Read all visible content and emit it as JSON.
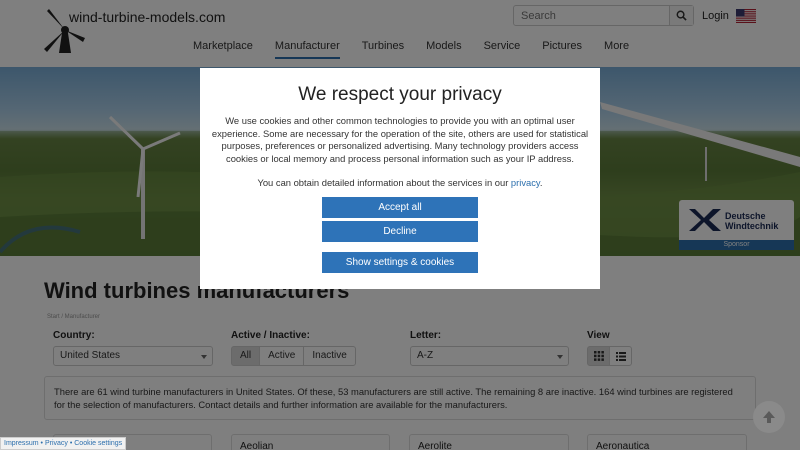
{
  "header": {
    "site_name": "wind-turbine-models.com",
    "search_placeholder": "Search",
    "login_label": "Login",
    "flag_icon": "us-flag-icon"
  },
  "nav": {
    "items": [
      {
        "label": "Marketplace",
        "active": false
      },
      {
        "label": "Manufacturer",
        "active": true
      },
      {
        "label": "Turbines",
        "active": false
      },
      {
        "label": "Models",
        "active": false
      },
      {
        "label": "Service",
        "active": false
      },
      {
        "label": "Pictures",
        "active": false
      },
      {
        "label": "More",
        "active": false
      }
    ]
  },
  "sponsor": {
    "name_line1": "Deutsche",
    "name_line2": "Windtechnik",
    "label": "Sponsor"
  },
  "main": {
    "title": "Wind turbines manufacturers",
    "breadcrumb": "Start / Manufacturer",
    "filters": {
      "country_label": "Country:",
      "country_value": "United States",
      "active_label": "Active / Inactive:",
      "active_options": [
        "All",
        "Active",
        "Inactive"
      ],
      "active_selected": "All",
      "letter_label": "Letter:",
      "letter_value": "A-Z",
      "view_label": "View"
    },
    "info_text": "There are 61 wind turbine manufacturers in United States. Of these, 53 manufacturers are still active. The remaining 8 are inactive. 164 wind turbines are registered for the selection of manufacturers. Contact details and further information are available for the manufacturers.",
    "cards": [
      "Aeolian",
      "Aerolite",
      "Aeronautica"
    ]
  },
  "footer": {
    "links": "Impressum • Privacy • Cookie settings"
  },
  "consent": {
    "title": "We respect your privacy",
    "text": "We use cookies and other common technologies to provide you with an optimal user experience. Some are necessary for the operation of the site, others are used for statistical purposes, preferences or personalized advertising. Many technology providers access cookies or local memory and process personal information such as your IP address.",
    "text2_prefix": "You can obtain detailed information about the services in our",
    "privacy_link": "privacy",
    "text2_suffix": ".",
    "accept_label": "Accept all",
    "decline_label": "Decline",
    "settings_label": "Show settings & cookies"
  },
  "colors": {
    "accent": "#2e73b8",
    "overlay": "rgba(0,0,0,0.5)"
  }
}
